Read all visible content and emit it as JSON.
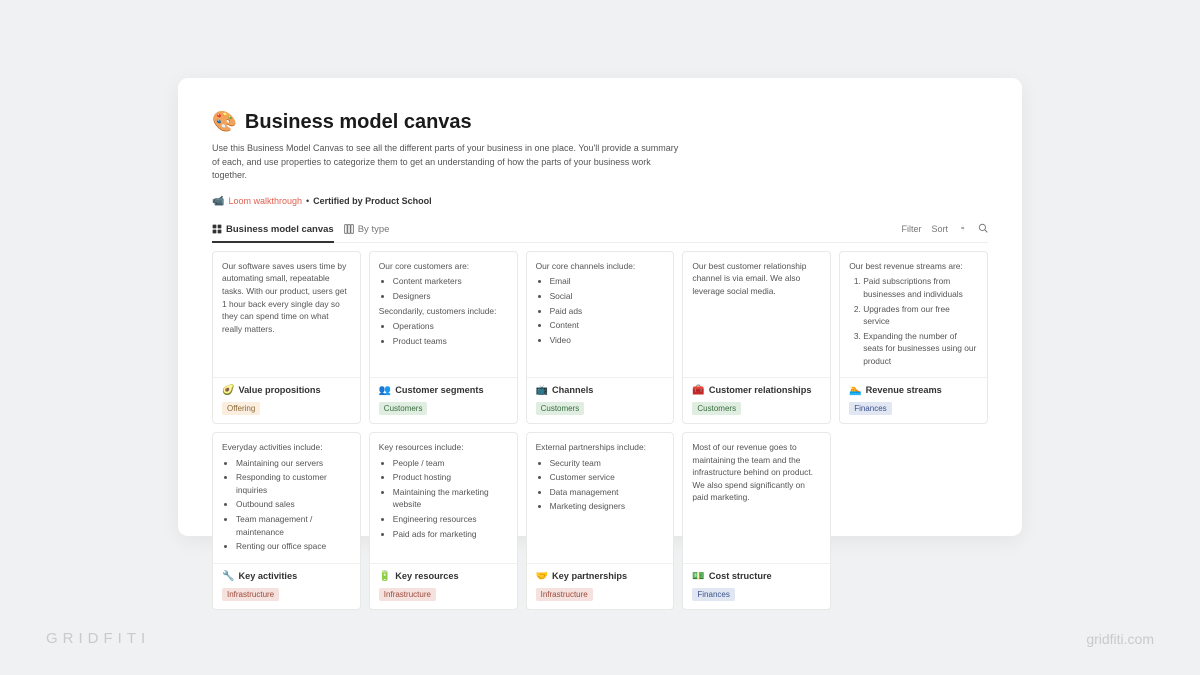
{
  "page": {
    "title_icon": "🎨",
    "title": "Business model canvas",
    "description": "Use this Business Model Canvas to see all the different parts of your business in one place. You'll provide a summary of each, and use properties to categorize them to get an understanding of how the parts of your business work together.",
    "walkthrough_icon": "📹",
    "walkthrough_label": "Loom walkthrough",
    "meta_separator": "•",
    "certified_label": "Certified by Product School"
  },
  "tabs": {
    "active": {
      "label": "Business model canvas"
    },
    "secondary": {
      "label": "By type"
    },
    "filter": "Filter",
    "sort": "Sort"
  },
  "tags": {
    "offering": "Offering",
    "customers": "Customers",
    "finances": "Finances",
    "infrastructure": "Infrastructure"
  },
  "cards": [
    {
      "body_text": "Our software saves users time by automating small, repeatable tasks. With our product, users get 1 hour back every single day so they can spend time on what really matters.",
      "emoji": "🥑",
      "title": "Value propositions",
      "tag": "offering"
    },
    {
      "intro1": "Our core customers are:",
      "list1": [
        "Content marketers",
        "Designers"
      ],
      "intro2": "Secondarily, customers include:",
      "list2": [
        "Operations",
        "Product teams"
      ],
      "emoji": "👥",
      "title": "Customer segments",
      "tag": "customers"
    },
    {
      "intro": "Our core channels include:",
      "list": [
        "Email",
        "Social",
        "Paid ads",
        "Content",
        "Video"
      ],
      "emoji": "📺",
      "title": "Channels",
      "tag": "customers"
    },
    {
      "body_text": "Our best customer relationship channel is via email. We also leverage social media.",
      "emoji": "🧰",
      "title": "Customer relationships",
      "tag": "customers"
    },
    {
      "intro": "Our best revenue streams are:",
      "olist": [
        "Paid subscriptions from businesses and individuals",
        "Upgrades from our free service",
        "Expanding the number of seats for businesses using our product"
      ],
      "emoji": "🏊",
      "title": "Revenue streams",
      "tag": "finances"
    },
    {
      "intro": "Everyday activities include:",
      "list": [
        "Maintaining our servers",
        "Responding to customer inquiries",
        "Outbound sales",
        "Team management / maintenance",
        "Renting our office space"
      ],
      "emoji": "🔧",
      "title": "Key activities",
      "tag": "infrastructure"
    },
    {
      "intro": "Key resources include:",
      "list": [
        "People / team",
        "Product hosting",
        "Maintaining the marketing website",
        "Engineering resources",
        "Paid ads for marketing"
      ],
      "emoji": "🔋",
      "title": "Key resources",
      "tag": "infrastructure"
    },
    {
      "intro": "External partnerships include:",
      "list": [
        "Security team",
        "Customer service",
        "Data management",
        "Marketing designers"
      ],
      "emoji": "🤝",
      "title": "Key partnerships",
      "tag": "infrastructure"
    },
    {
      "body_text": "Most of our revenue goes to maintaining the team and the infrastructure behind on product. We also spend significantly on paid marketing.",
      "emoji": "💵",
      "title": "Cost structure",
      "tag": "finances"
    }
  ],
  "watermark": {
    "left": "GRIDFITI",
    "right": "gridfiti.com"
  }
}
